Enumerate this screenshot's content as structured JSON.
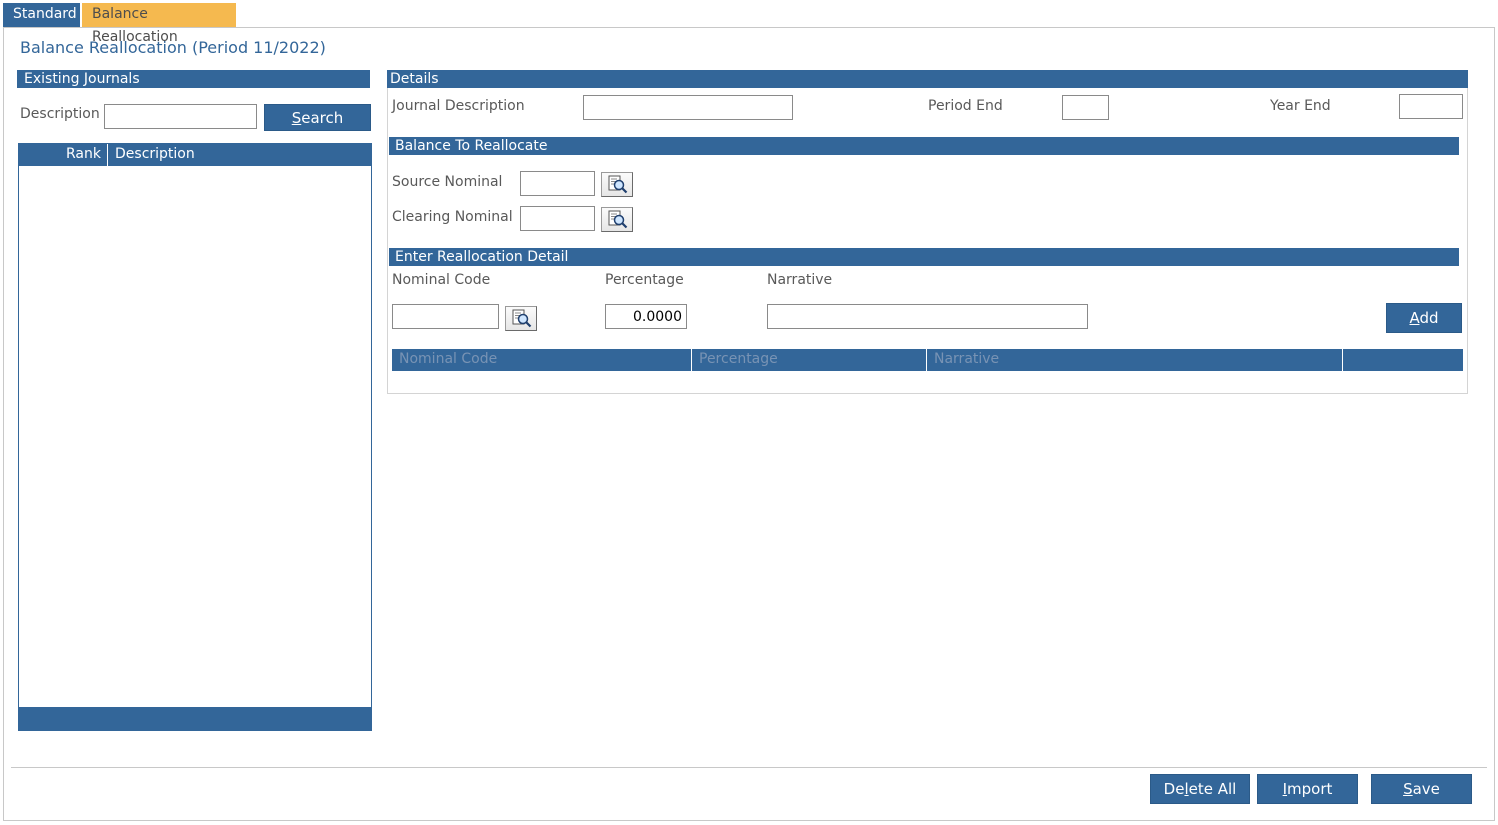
{
  "tabs": [
    {
      "label": "Standard",
      "active": false
    },
    {
      "label": "Balance Reallocation",
      "active": true
    }
  ],
  "page_title": "Balance Reallocation (Period 11/2022)",
  "existing_journals": {
    "title": "Existing Journals",
    "description_label": "Description",
    "description_value": "",
    "search_button": {
      "pre": "",
      "accel": "S",
      "post": "earch"
    },
    "columns": [
      "Rank",
      "Description"
    ],
    "rows": []
  },
  "details": {
    "title": "Details",
    "journal_description_label": "Journal Description",
    "journal_description_value": "",
    "period_end_label": "Period End",
    "period_end_value": "",
    "year_end_label": "Year End",
    "year_end_value": ""
  },
  "balance_to_reallocate": {
    "title": "Balance To Reallocate",
    "source_nominal_label": "Source Nominal",
    "source_nominal_value": "",
    "clearing_nominal_label": "Clearing Nominal",
    "clearing_nominal_value": ""
  },
  "reallocation_detail": {
    "title": "Enter Reallocation Detail",
    "nominal_code_label": "Nominal Code",
    "nominal_code_value": "",
    "percentage_label": "Percentage",
    "percentage_value": "0.0000",
    "narrative_label": "Narrative",
    "narrative_value": "",
    "add_button": {
      "pre": "",
      "accel": "A",
      "post": "dd"
    },
    "grid_columns": [
      "Nominal Code",
      "Percentage",
      "Narrative",
      ""
    ]
  },
  "footer_buttons": {
    "delete_all": {
      "pre": "De",
      "accel": "l",
      "post": "ete All"
    },
    "import": {
      "pre": "",
      "accel": "I",
      "post": "mport"
    },
    "save": {
      "pre": "",
      "accel": "S",
      "post": "ave"
    }
  },
  "colors": {
    "primary": "#336699",
    "active_tab": "#f5b94f",
    "header_text_muted": "#7893b4"
  },
  "icons": {
    "lookup": "magnifier-document-icon"
  }
}
